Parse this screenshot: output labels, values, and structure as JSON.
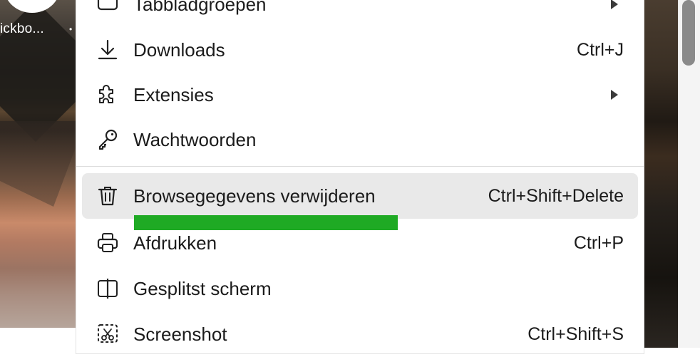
{
  "profile": {
    "name": "ickbo...",
    "dot": "•"
  },
  "menu": {
    "items": [
      {
        "id": "tabgroups",
        "label": "Tabbladgroepen",
        "shortcut": "",
        "submenu": true,
        "icon": "tab-groups-icon"
      },
      {
        "id": "downloads",
        "label": "Downloads",
        "shortcut": "Ctrl+J",
        "submenu": false,
        "icon": "download-icon"
      },
      {
        "id": "extensions",
        "label": "Extensies",
        "shortcut": "",
        "submenu": true,
        "icon": "puzzle-icon"
      },
      {
        "id": "passwords",
        "label": "Wachtwoorden",
        "shortcut": "",
        "submenu": false,
        "icon": "key-icon"
      },
      {
        "id": "clear-data",
        "label": "Browsegegevens verwijderen",
        "shortcut": "Ctrl+Shift+Delete",
        "submenu": false,
        "icon": "trash-icon",
        "highlighted": true
      },
      {
        "id": "print",
        "label": "Afdrukken",
        "shortcut": "Ctrl+P",
        "submenu": false,
        "icon": "printer-icon"
      },
      {
        "id": "split-screen",
        "label": "Gesplitst scherm",
        "shortcut": "",
        "submenu": false,
        "icon": "split-screen-icon"
      },
      {
        "id": "screenshot",
        "label": "Screenshot",
        "shortcut": "Ctrl+Shift+S",
        "submenu": false,
        "icon": "screenshot-icon"
      }
    ]
  },
  "colors": {
    "highlight_row": "#e9e9e9",
    "annotation_underline": "#1faa24",
    "scroll_thumb": "#8a8a8a"
  }
}
